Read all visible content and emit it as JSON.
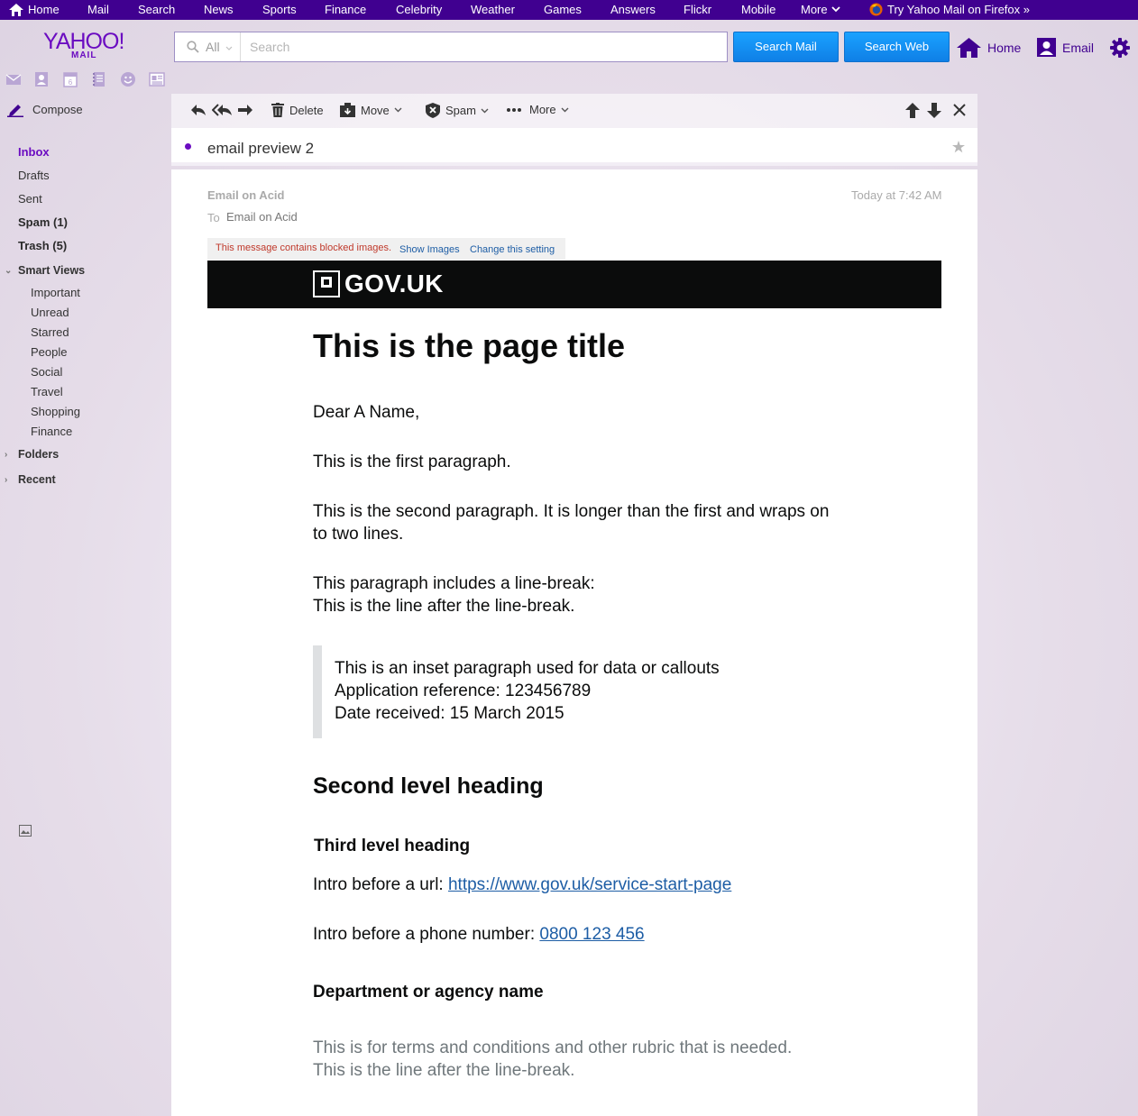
{
  "topnav": {
    "items": [
      "Home",
      "Mail",
      "Search",
      "News",
      "Sports",
      "Finance",
      "Celebrity",
      "Weather",
      "Games",
      "Answers",
      "Flickr",
      "Mobile",
      "More"
    ],
    "promo": "Try Yahoo Mail on Firefox »"
  },
  "header": {
    "logo_text": "YAHOO!",
    "logo_sub": "MAIL",
    "search_scope": "All",
    "search_placeholder": "Search",
    "search_mail_label": "Search Mail",
    "search_web_label": "Search Web",
    "home_label": "Home",
    "email_label": "Email"
  },
  "sidebar": {
    "compose_label": "Compose",
    "folders": [
      "Inbox",
      "Drafts",
      "Sent",
      "Spam (1)",
      "Trash (5)"
    ],
    "smart_views_label": "Smart Views",
    "smart_views": [
      "Important",
      "Unread",
      "Starred",
      "People",
      "Social",
      "Travel",
      "Shopping",
      "Finance"
    ],
    "folders_label": "Folders",
    "recent_label": "Recent"
  },
  "toolbar": {
    "delete_label": "Delete",
    "move_label": "Move",
    "spam_label": "Spam",
    "more_label": "More"
  },
  "message": {
    "subject": "email preview 2",
    "from": "Email on Acid",
    "to_label": "To",
    "to": "Email on Acid",
    "time": "Today at 7:42 AM",
    "blocked_text": "This message contains blocked images.",
    "show_images": "Show Images",
    "change_setting": "Change this setting"
  },
  "email_body": {
    "brand": "GOV.UK",
    "title": "This is the page title",
    "greeting": "Dear A Name,",
    "para1": "This is the first paragraph.",
    "para2_line1": "This is the second paragraph. It is longer than the first and wraps on",
    "para2_line2": "to two lines.",
    "para3_line1": "This paragraph includes a line-break:",
    "para3_line2": "This is the line after the line-break.",
    "inset_line1": "This is an inset paragraph used for data or callouts",
    "inset_line2": "Application reference: 123456789",
    "inset_line3": "Date received: 15 March 2015",
    "h2": "Second level heading",
    "h3": "Third level heading",
    "url_intro": "Intro before a url: ",
    "url": "https://www.gov.uk/service-start-page",
    "phone_intro": "Intro before a phone number: ",
    "phone": "0800 123 456",
    "department": "Department or agency name",
    "rubric_line1": "This is for terms and conditions and other rubric that is needed.",
    "rubric_line2": "This is the line after the line-break."
  },
  "colors": {
    "nav_bg": "#400090",
    "brand_purple": "#6b0cc1",
    "button_blue": "#188fff",
    "gov_black": "#0b0c0c",
    "link_blue": "#1d5da5",
    "blocked_red": "#c0392b"
  }
}
